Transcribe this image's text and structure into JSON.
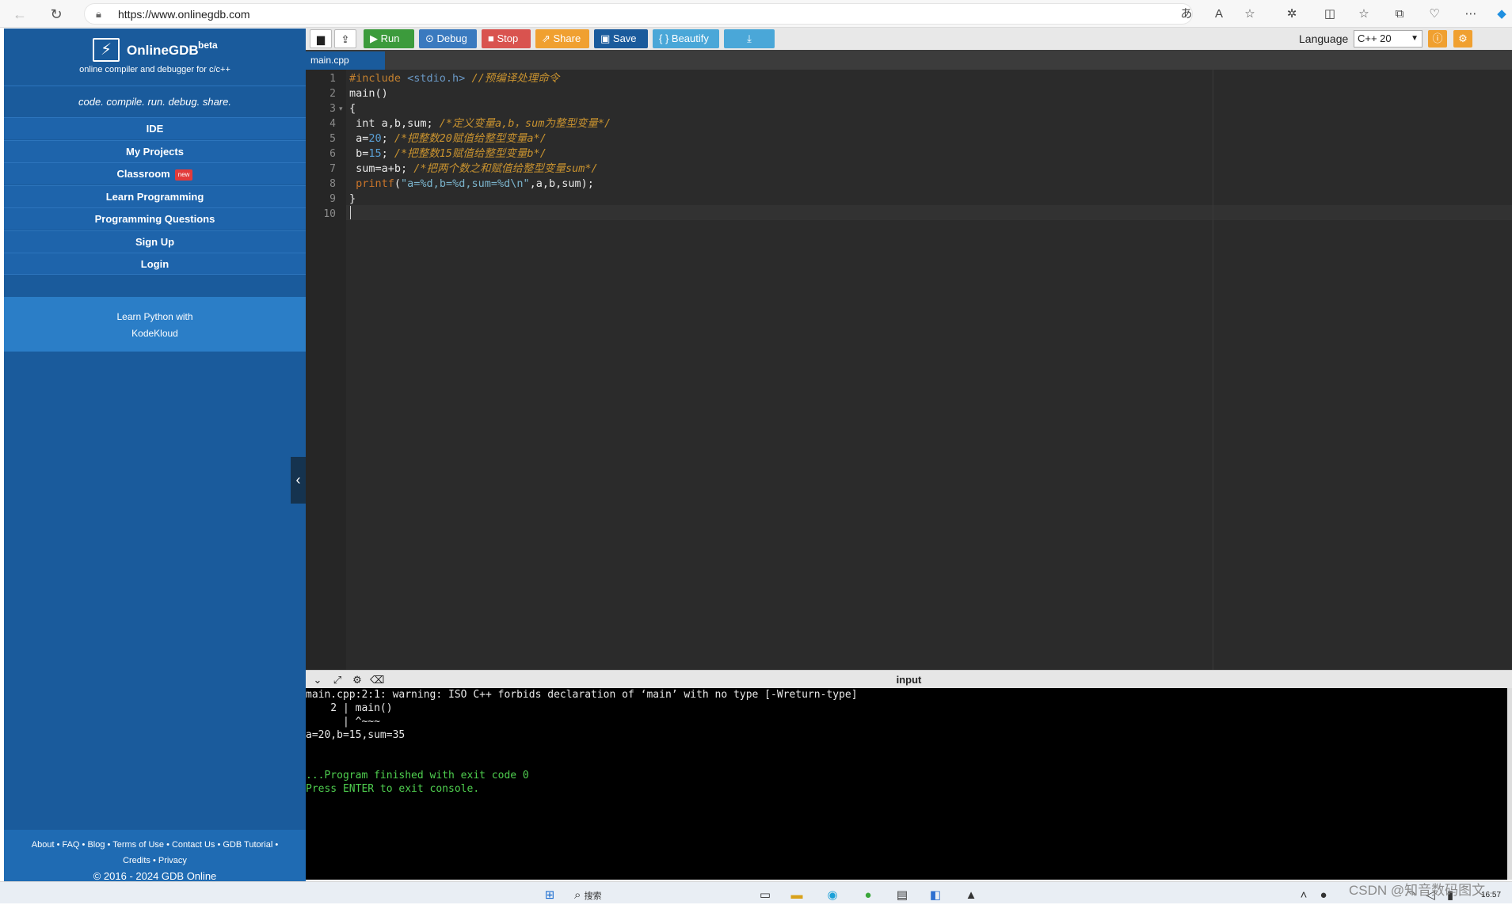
{
  "browser": {
    "url": "https://www.onlinegdb.com"
  },
  "sidebar": {
    "brand": "OnlineGDB",
    "beta": "beta",
    "subtitle": "online compiler and debugger for c/c++",
    "tagline": "code. compile. run. debug. share.",
    "menu": [
      {
        "label": "IDE"
      },
      {
        "label": "My Projects"
      },
      {
        "label": "Classroom",
        "badge": "new"
      },
      {
        "label": "Learn Programming"
      },
      {
        "label": "Programming Questions"
      },
      {
        "label": "Sign Up"
      },
      {
        "label": "Login"
      }
    ],
    "promo_line1": "Learn Python with",
    "promo_line2": "KodeKloud",
    "footer_line1": "About • FAQ • Blog • Terms of Use • Contact Us • GDB Tutorial •",
    "footer_line2": "Credits • Privacy",
    "copyright": "© 2016 - 2024 GDB Online"
  },
  "toolbar": {
    "run": "Run",
    "debug": "Debug",
    "stop": "Stop",
    "share": "Share",
    "save": "Save",
    "beautify": "{ } Beautify",
    "language_label": "Language",
    "language_value": "C++ 20",
    "colors": {
      "run": "#3c9b3c",
      "debug": "#3a7abf",
      "stop": "#d9534f",
      "share": "#f0a030",
      "save": "#1a5b9c",
      "beautify": "#4aa7d8",
      "download": "#4aa7d8"
    }
  },
  "editor": {
    "file_tab": "main.cpp",
    "line_numbers": [
      "1",
      "2",
      "3",
      "4",
      "5",
      "6",
      "7",
      "8",
      "9",
      "10"
    ],
    "lines": [
      {
        "segments": [
          {
            "t": "#include ",
            "c": "c-pp"
          },
          {
            "t": "<stdio.h>",
            "c": "c-inc"
          },
          {
            "t": " //预编译处理命令",
            "c": "c-cm"
          }
        ]
      },
      {
        "segments": [
          {
            "t": "main()",
            "c": ""
          }
        ]
      },
      {
        "segments": [
          {
            "t": "{",
            "c": ""
          }
        ]
      },
      {
        "segments": [
          {
            "t": " int a,b,sum; ",
            "c": ""
          },
          {
            "t": "/*定义变量a,b，sum为整型变量*/",
            "c": "c-cm"
          }
        ]
      },
      {
        "segments": [
          {
            "t": " a=",
            "c": ""
          },
          {
            "t": "20",
            "c": "c-num"
          },
          {
            "t": "; ",
            "c": ""
          },
          {
            "t": "/*把整数20赋值给整型变量a*/",
            "c": "c-cm"
          }
        ]
      },
      {
        "segments": [
          {
            "t": " b=",
            "c": ""
          },
          {
            "t": "15",
            "c": "c-num"
          },
          {
            "t": "; ",
            "c": ""
          },
          {
            "t": "/*把整数15赋值给整型变量b*/",
            "c": "c-cm"
          }
        ]
      },
      {
        "segments": [
          {
            "t": " sum=a+b; ",
            "c": ""
          },
          {
            "t": "/*把两个数之和赋值给整型变量sum*/",
            "c": "c-cm"
          }
        ]
      },
      {
        "segments": [
          {
            "t": " printf",
            "c": "c-fn"
          },
          {
            "t": "(",
            "c": ""
          },
          {
            "t": "\"a=%d,b=%d,sum=%d\\n\"",
            "c": "c-str"
          },
          {
            "t": ",a,b,sum);",
            "c": ""
          }
        ]
      },
      {
        "segments": [
          {
            "t": "}",
            "c": ""
          }
        ]
      },
      {
        "segments": [
          {
            "t": "",
            "c": ""
          }
        ]
      }
    ]
  },
  "console": {
    "label": "input",
    "lines": [
      {
        "text": "main.cpp:2:1: warning: ISO C++ forbids declaration of ‘main’ with no type [-Wreturn-type]",
        "green": false
      },
      {
        "text": "    2 | main()",
        "green": false
      },
      {
        "text": "      | ^~~~",
        "green": false
      },
      {
        "text": "a=20,b=15,sum=35",
        "green": false
      },
      {
        "text": "",
        "green": false
      },
      {
        "text": "",
        "green": false
      },
      {
        "text": "...Program finished with exit code 0",
        "green": true
      },
      {
        "text": "Press ENTER to exit console.",
        "green": true
      }
    ]
  },
  "taskbar": {
    "search_text": "搜索",
    "watermark": "CSDN @知音数码图文",
    "time": "16:57"
  }
}
